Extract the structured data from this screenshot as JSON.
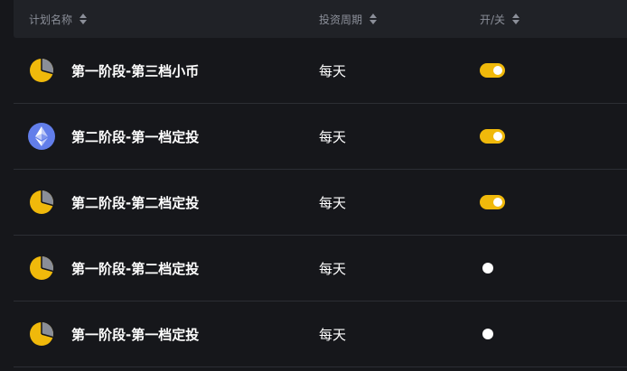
{
  "header": {
    "col_name": "计划名称",
    "col_period": "投资周期",
    "col_switch": "开/关"
  },
  "colors": {
    "accent": "#f0b90b",
    "eth": "#627eea",
    "background": "#16171b",
    "header_bg": "#202227"
  },
  "rows": [
    {
      "icon": "pie-chart-icon",
      "name": "第一阶段-第三档小币",
      "period": "每天",
      "enabled": true
    },
    {
      "icon": "ethereum-icon",
      "name": "第二阶段-第一档定投",
      "period": "每天",
      "enabled": true
    },
    {
      "icon": "pie-chart-icon",
      "name": "第二阶段-第二档定投",
      "period": "每天",
      "enabled": true
    },
    {
      "icon": "pie-chart-icon",
      "name": "第一阶段-第二档定投",
      "period": "每天",
      "enabled": false
    },
    {
      "icon": "pie-chart-icon",
      "name": "第一阶段-第一档定投",
      "period": "每天",
      "enabled": false
    }
  ]
}
